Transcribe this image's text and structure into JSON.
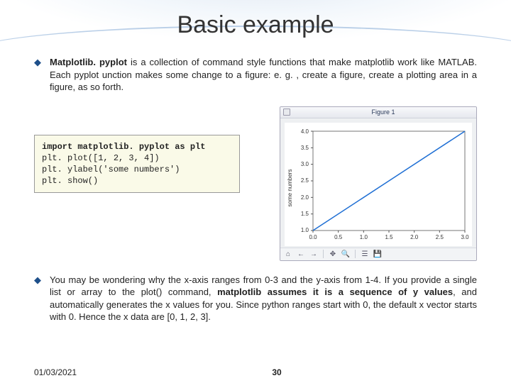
{
  "title": "Basic example",
  "bullet1_lead": "Matplotlib. pyplot ",
  "bullet1_rest": "is a collection of command style functions that make matplotlib work like MATLAB. Each pyplot unction makes some change to a figure: e. g. , create a figure, create a plotting area in a figure, as so forth.",
  "code_line1": "import matplotlib. pyplot as plt",
  "code_line2": "plt. plot([1, 2, 3, 4])",
  "code_line3": "plt. ylabel('some numbers')",
  "code_line4": "plt. show()",
  "figure": {
    "title": "Figure 1",
    "ylabel": "some numbers"
  },
  "bullet2_a": "You may be wondering why the x-axis ranges from 0-3 and the y-axis from 1-4. If you provide a single list or array to the plot() command, ",
  "bullet2_b": "matplotlib assumes it is a sequence of y values",
  "bullet2_c": ", and automatically generates the x values for you. Since python ranges start with 0, the default x vector starts with 0. Hence the x data are [0, 1, 2, 3].",
  "footer_date": "01/03/2021",
  "footer_page": "30",
  "chart_data": {
    "type": "line",
    "x": [
      0.0,
      1.0,
      2.0,
      3.0
    ],
    "y": [
      1.0,
      2.0,
      3.0,
      4.0
    ],
    "xlabel": "",
    "ylabel": "some numbers",
    "title": "",
    "xlim": [
      0.0,
      3.0
    ],
    "ylim": [
      1.0,
      4.0
    ],
    "xticks": [
      0.0,
      0.5,
      1.0,
      1.5,
      2.0,
      2.5,
      3.0
    ],
    "yticks": [
      1.0,
      1.5,
      2.0,
      2.5,
      3.0,
      3.5,
      4.0
    ]
  }
}
